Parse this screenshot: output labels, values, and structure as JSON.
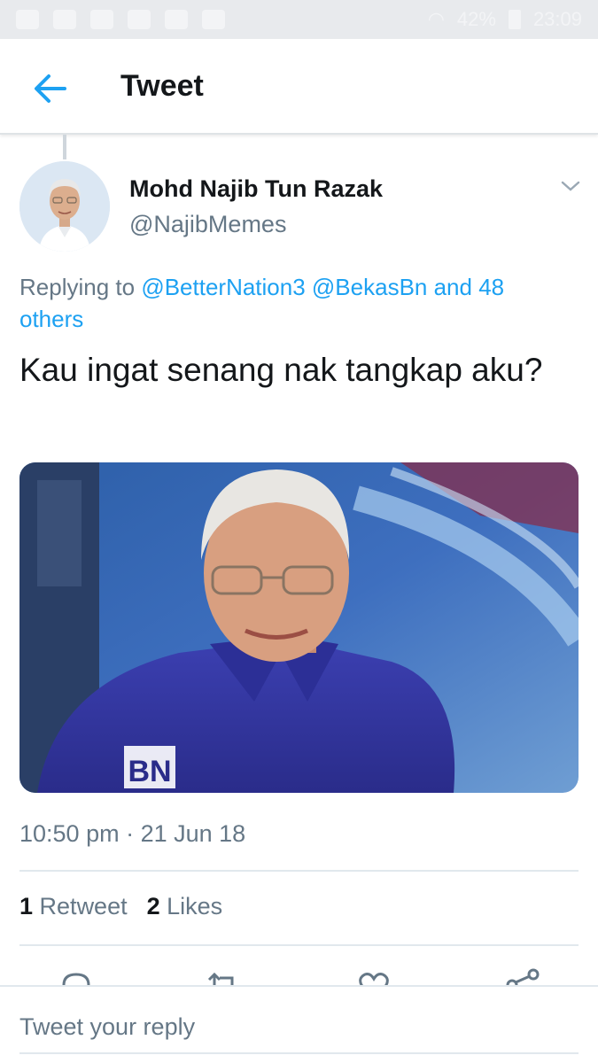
{
  "status_bar": {
    "battery": "42%",
    "time": "23:09"
  },
  "header": {
    "title": "Tweet",
    "back_icon": "arrow-left-icon"
  },
  "tweet": {
    "display_name": "Mohd Najib Tun Razak",
    "username": "@NajibMemes",
    "reply_prefix": "Replying to ",
    "reply_mentions": "@BetterNation3 @BekasBn and 48 others",
    "text": "Kau ingat senang nak tangkap aku?",
    "media_badge": "BN",
    "timestamp": "10:50 pm · 21 Jun 18",
    "retweet_count": "1",
    "retweet_label": "Retweet",
    "like_count": "2",
    "like_label": "Likes"
  },
  "reply_bar": {
    "placeholder": "Tweet your reply"
  },
  "colors": {
    "accent": "#1da1f2",
    "secondary_text": "#657786",
    "primary_text": "#14171a",
    "divider": "#e1e8ed"
  }
}
